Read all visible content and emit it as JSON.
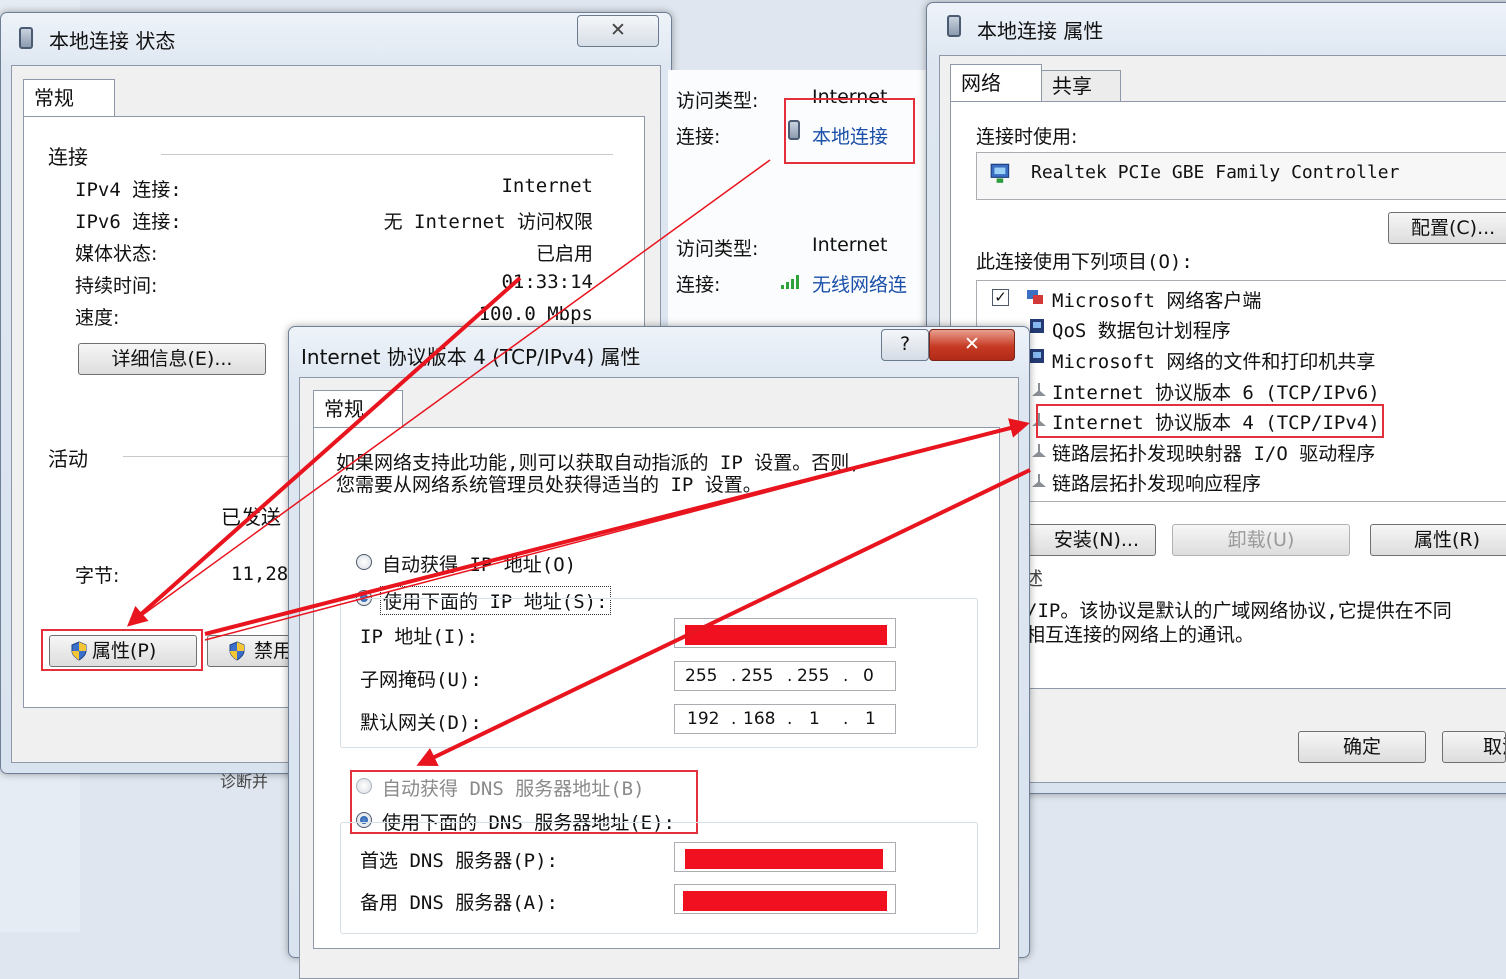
{
  "status_window": {
    "title": "本地连接 状态",
    "tab": "常规",
    "group_connection": "连接",
    "rows": [
      {
        "label": "IPv4 连接:",
        "value": "Internet"
      },
      {
        "label": "IPv6 连接:",
        "value": "无 Internet 访问权限"
      },
      {
        "label": "媒体状态:",
        "value": "已启用"
      },
      {
        "label": "持续时间:",
        "value": "01:33:14"
      },
      {
        "label": "速度:",
        "value": "100.0 Mbps"
      }
    ],
    "details_button": "详细信息(E)...",
    "group_activity": "活动",
    "sent_label": "已发送",
    "bytes_label": "字节:",
    "bytes_value": "11,28",
    "properties_button": "属性(P)",
    "disable_button": "禁用",
    "diagnose_partial": "诊断并"
  },
  "middle_strip": {
    "rows": [
      {
        "label": "访问类型:",
        "value": "Internet"
      },
      {
        "label": "连接:",
        "value": "本地连接"
      },
      {
        "label": "访问类型:",
        "value": "Internet"
      },
      {
        "label": "连接:",
        "value": "无线网络连"
      }
    ]
  },
  "props_window": {
    "title": "本地连接 属性",
    "tabs": [
      "网络",
      "共享"
    ],
    "connect_using_label": "连接时使用:",
    "adapter_name": "Realtek PCIe GBE Family Controller",
    "configure_button": "配置(C)...",
    "items_label": "此连接使用下列项目(O):",
    "items": [
      "Microsoft 网络客户端",
      "QoS 数据包计划程序",
      "Microsoft 网络的文件和打印机共享",
      "Internet 协议版本 6 (TCP/IPv6)",
      "Internet 协议版本 4 (TCP/IPv4)",
      "链路层拓扑发现映射器 I/O 驱动程序",
      "链路层拓扑发现响应程序"
    ],
    "install_button": "安装(N)...",
    "uninstall_button": "卸载(U)",
    "properties_button": "属性(R)",
    "description_heading": "述",
    "description_line1": "/IP。该协议是默认的广域网络协议,它提供在不同",
    "description_line2": "相互连接的网络上的通讯。",
    "ok_button": "确定",
    "cancel_button": "取消"
  },
  "ipv4_dialog": {
    "title": "Internet 协议版本 4 (TCP/IPv4) 属性",
    "help_glyph": "?",
    "close_glyph": "✕",
    "tab": "常规",
    "intro_line1": "如果网络支持此功能,则可以获取自动指派的 IP 设置。否则,",
    "intro_line2": "您需要从网络系统管理员处获得适当的 IP 设置。",
    "auto_ip": "自动获得 IP 地址(O)",
    "manual_ip": "使用下面的 IP 地址(S):",
    "ip_label": "IP 地址(I):",
    "mask_label": "子网掩码(U):",
    "mask_value": [
      "255",
      "255",
      "255",
      "0"
    ],
    "gateway_label": "默认网关(D):",
    "gateway_value": [
      "192",
      "168",
      "1",
      "1"
    ],
    "auto_dns": "自动获得 DNS 服务器地址(B)",
    "manual_dns": "使用下面的 DNS 服务器地址(E):",
    "preferred_dns_label": "首选 DNS 服务器(P):",
    "alternate_dns_label": "备用 DNS 服务器(A):"
  },
  "colors": {
    "annotation_red": "#e3303b",
    "redacted_fill": "#f01020"
  }
}
